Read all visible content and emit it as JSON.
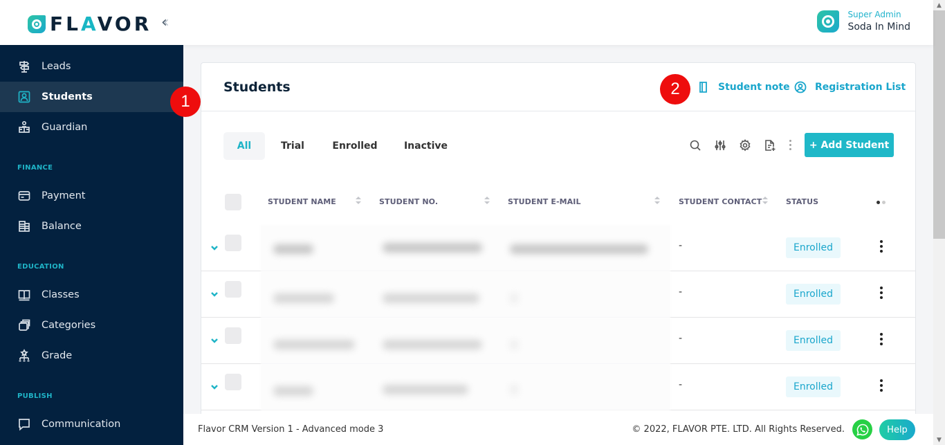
{
  "app": {
    "logo_text_pre": "FL",
    "logo_text_accent": "A",
    "logo_text_post": "VOR",
    "collapse_icon": "double-chevron-left-icon"
  },
  "user": {
    "role": "Super Admin",
    "name": "Soda In Mind"
  },
  "sidebar": {
    "items": [
      {
        "label": "Leads",
        "icon": "signpost-icon",
        "active": false
      },
      {
        "label": "Students",
        "icon": "student-icon",
        "active": true
      },
      {
        "label": "Guardian",
        "icon": "guardian-icon",
        "active": false
      },
      {
        "label": "Payment",
        "icon": "card-icon",
        "active": false
      },
      {
        "label": "Balance",
        "icon": "ledger-icon",
        "active": false
      },
      {
        "label": "Classes",
        "icon": "book-icon",
        "active": false
      },
      {
        "label": "Categories",
        "icon": "layers-icon",
        "active": false
      },
      {
        "label": "Grade",
        "icon": "hierarchy-icon",
        "active": false
      },
      {
        "label": "Communication",
        "icon": "chat-icon",
        "active": false
      }
    ],
    "sections": {
      "finance": "FINANCE",
      "education": "EDUCATION",
      "publish": "PUBLISH"
    }
  },
  "annotations": {
    "badge_1": "1",
    "badge_2": "2"
  },
  "card": {
    "title": "Students",
    "links": {
      "student_note": "Student note",
      "registration_list": "Registration List"
    },
    "tabs": [
      {
        "label": "All",
        "active": true
      },
      {
        "label": "Trial",
        "active": false
      },
      {
        "label": "Enrolled",
        "active": false
      },
      {
        "label": "Inactive",
        "active": false
      }
    ],
    "toolbar": {
      "icons": [
        "search-icon",
        "filter-sliders-icon",
        "gear-icon",
        "export-document-icon",
        "more-vertical-icon"
      ],
      "add_label": "+ Add Student"
    },
    "table": {
      "columns": [
        "STUDENT NAME",
        "STUDENT NO.",
        "STUDENT E-MAIL",
        "STUDENT CONTACT",
        "STATUS"
      ],
      "rows": [
        {
          "name": "[redacted]",
          "number": "[redacted]",
          "email": "[redacted]",
          "contact": "-",
          "status": "Enrolled"
        },
        {
          "name": "[redacted]",
          "number": "[redacted]",
          "email": "-",
          "contact": "-",
          "status": "Enrolled"
        },
        {
          "name": "[redacted]",
          "number": "[redacted]",
          "email": "-",
          "contact": "-",
          "status": "Enrolled"
        },
        {
          "name": "[redacted]",
          "number": "[redacted]",
          "email": "-",
          "contact": "-",
          "status": "Enrolled"
        }
      ]
    }
  },
  "footer": {
    "version": "Flavor CRM Version 1 - Advanced mode 3",
    "copyright": "© 2022, FLAVOR PTE. LTD. All Rights Reserved.",
    "help": "Help"
  },
  "colors": {
    "accent": "#1fb4c7",
    "sidebar_bg": "#03213f",
    "badge_red": "#ee0d0d",
    "whatsapp": "#27d045"
  }
}
